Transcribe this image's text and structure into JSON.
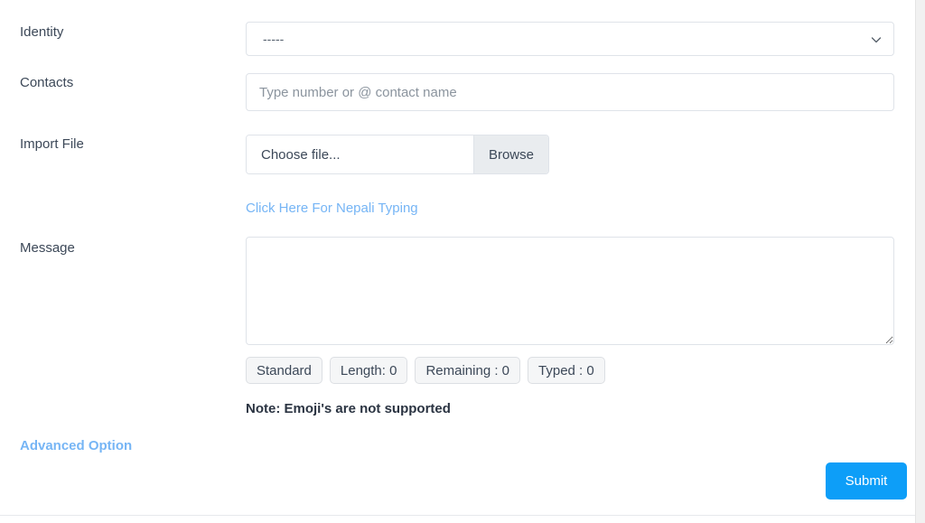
{
  "form": {
    "rows": [
      {
        "label": "Identity",
        "control": "identity-select"
      },
      {
        "label": "Contacts",
        "control": "contacts-input"
      },
      {
        "label": "Import File",
        "control": "import-file"
      },
      {
        "label": "Message",
        "control": "message-textarea"
      }
    ],
    "identity": {
      "label": "Identity",
      "selected_value": "-----",
      "options": [
        "-----"
      ],
      "chevron_icon": "chevron-down-icon"
    },
    "contacts": {
      "label": "Contacts",
      "value": "",
      "placeholder": "Type number or @ contact name"
    },
    "import_file": {
      "label": "Import File",
      "file_name": "Choose file...",
      "browse_label": "Browse"
    },
    "nepali_typing_link": "Click Here For Nepali Typing",
    "message": {
      "label": "Message",
      "value": "",
      "placeholder": ""
    },
    "counters": [
      {
        "label": "Standard"
      },
      {
        "label": "Length: 0"
      },
      {
        "label": "Remaining : 0"
      },
      {
        "label": "Typed : 0"
      }
    ],
    "note": "Note: Emoji's are not supported",
    "advanced_option_link": "Advanced Option",
    "submit_label": "Submit"
  },
  "colors": {
    "accent_blue": "#0d9ef8",
    "link_blue": "#76b5f5",
    "label_text": "#3c4858",
    "border": "#dfe3e9",
    "badge_bg": "#f5f6f7",
    "browse_bg": "#e9ecef",
    "placeholder": "#8b949e"
  }
}
